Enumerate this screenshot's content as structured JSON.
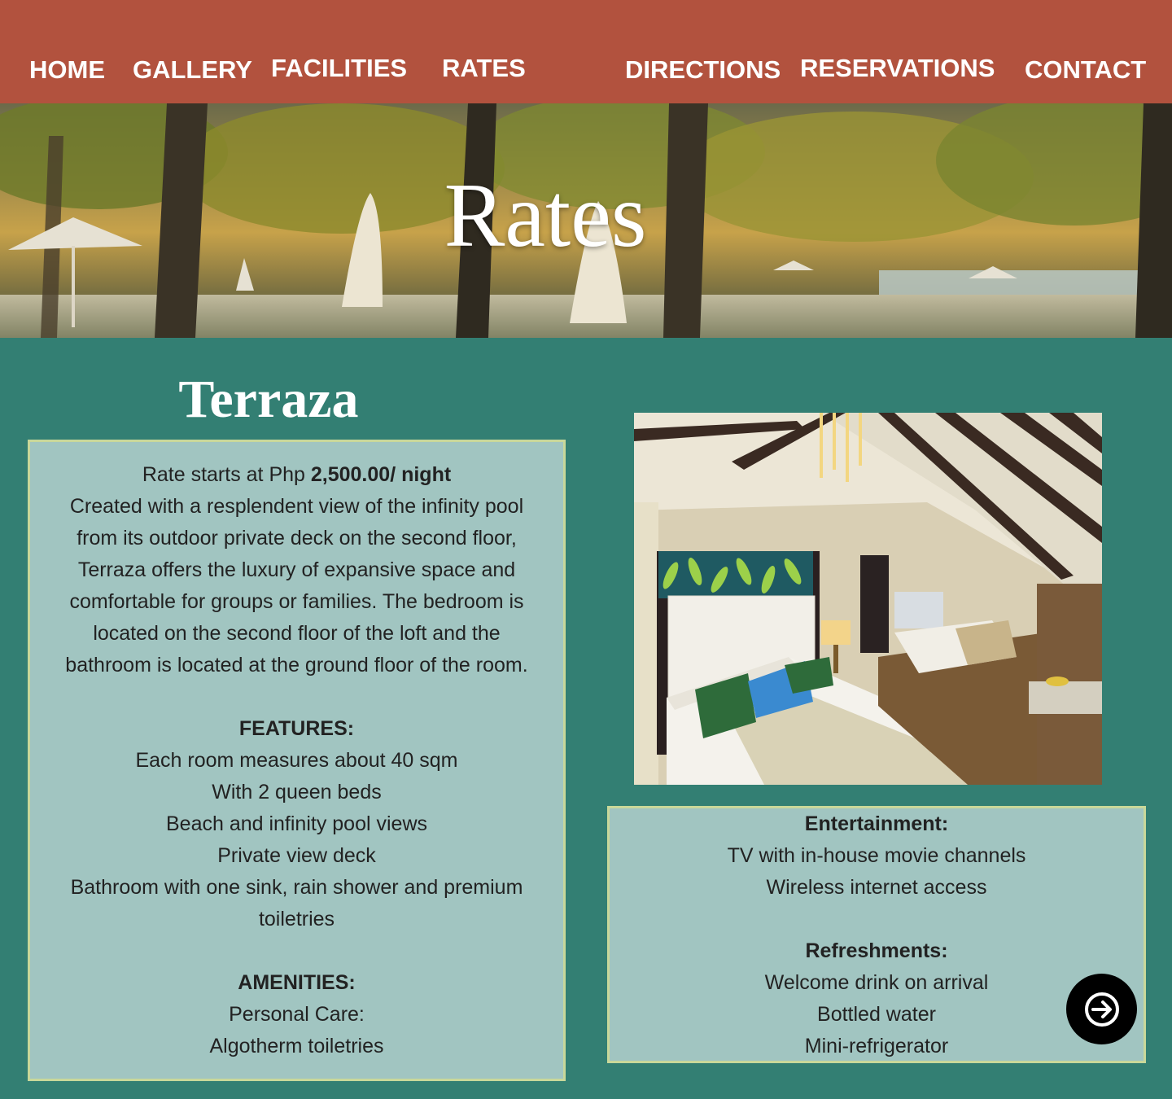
{
  "nav": {
    "items": [
      "HOME",
      "GALLERY",
      "FACILITIES",
      "RATES",
      "DIRECTIONS",
      "RESERVATIONS",
      "CONTACT"
    ]
  },
  "hero": {
    "title": "Rates"
  },
  "room": {
    "name": "Terraza",
    "rate_prefix": "Rate starts at Php ",
    "rate_value": "2,500.00/ night",
    "description_lines": [
      "Created with a resplendent view of the infinity pool",
      "from its outdoor private deck on the second floor,",
      "Terraza offers the luxury of expansive space and",
      "comfortable for groups or families.  The bedroom is",
      "located on the second floor of the loft and the",
      "bathroom is located at the ground floor of the room."
    ],
    "features_heading": "FEATURES:",
    "features": [
      "Each room measures about 40 sqm",
      "With 2 queen beds",
      "Beach and infinity pool views",
      "Private view deck",
      "Bathroom with one sink, rain shower and premium",
      "toiletries"
    ],
    "amenities_heading": "AMENITIES:",
    "personal_care_label": "Personal Care:",
    "personal_care_items": [
      "Algotherm toiletries"
    ],
    "entertainment_heading": "Entertainment:",
    "entertainment_items": [
      "TV with in-house movie channels",
      "Wireless internet access"
    ],
    "refreshments_heading": "Refreshments:",
    "refreshments_items": [
      "Welcome drink on arrival",
      "Bottled water",
      "Mini-refrigerator"
    ]
  },
  "next_button": {
    "icon": "arrow-right-icon"
  },
  "colors": {
    "nav_bg": "#b2523e",
    "page_bg": "#337f73",
    "card_bg": "#a1c5c1",
    "card_border": "#c9d89a"
  }
}
